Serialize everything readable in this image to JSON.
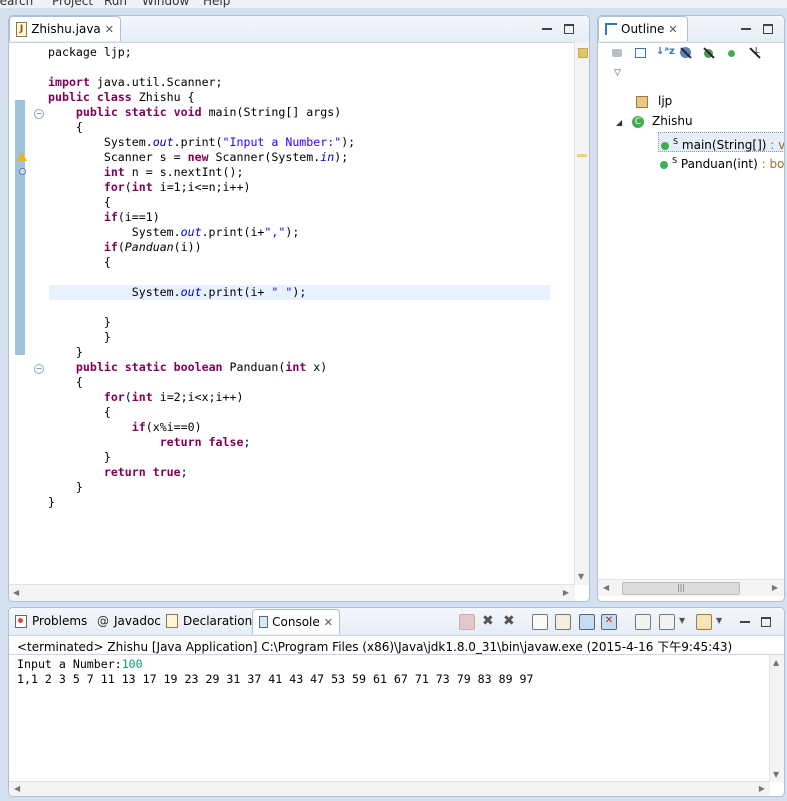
{
  "menubar": {
    "items": [
      "Search",
      "Project",
      "Run",
      "Window",
      "Help"
    ]
  },
  "editor": {
    "tab_label": "Zhishu.java",
    "lines": [
      [
        [
          "t",
          "package ljp;"
        ]
      ],
      [],
      [
        [
          "k",
          "import"
        ],
        [
          "t",
          " java.util.Scanner;"
        ]
      ],
      [
        [
          "k",
          "public"
        ],
        [
          "t",
          " "
        ],
        [
          "k",
          "class"
        ],
        [
          "t",
          " Zhishu {"
        ]
      ],
      [
        [
          "t",
          "    "
        ],
        [
          "k",
          "public"
        ],
        [
          "t",
          " "
        ],
        [
          "k",
          "static"
        ],
        [
          "t",
          " "
        ],
        [
          "k",
          "void"
        ],
        [
          "t",
          " main(String[] args)"
        ]
      ],
      [
        [
          "t",
          "    {"
        ]
      ],
      [
        [
          "t",
          "        System."
        ],
        [
          "f",
          "out"
        ],
        [
          "t",
          ".print("
        ],
        [
          "s",
          "\"Input a Number:\""
        ],
        [
          "t",
          ");"
        ]
      ],
      [
        [
          "t",
          "        Scanner s = "
        ],
        [
          "k",
          "new"
        ],
        [
          "t",
          " Scanner(System."
        ],
        [
          "f",
          "in"
        ],
        [
          "t",
          ");"
        ]
      ],
      [
        [
          "t",
          "        "
        ],
        [
          "k",
          "int"
        ],
        [
          "t",
          " n = s.nextInt();"
        ]
      ],
      [
        [
          "t",
          "        "
        ],
        [
          "k",
          "for"
        ],
        [
          "t",
          "("
        ],
        [
          "k",
          "int"
        ],
        [
          "t",
          " i=1;i<=n;i++)"
        ]
      ],
      [
        [
          "t",
          "        {"
        ]
      ],
      [
        [
          "t",
          "        "
        ],
        [
          "k",
          "if"
        ],
        [
          "t",
          "(i==1)"
        ]
      ],
      [
        [
          "t",
          "            System."
        ],
        [
          "f",
          "out"
        ],
        [
          "t",
          ".print(i+"
        ],
        [
          "s",
          "\",\""
        ],
        [
          "t",
          ");"
        ]
      ],
      [
        [
          "t",
          "        "
        ],
        [
          "k",
          "if"
        ],
        [
          "t",
          "("
        ],
        [
          "i",
          "Panduan"
        ],
        [
          "t",
          "(i))"
        ]
      ],
      [
        [
          "t",
          "        {"
        ]
      ],
      [],
      [
        [
          "t",
          "            System."
        ],
        [
          "f",
          "out"
        ],
        [
          "t",
          ".print(i+ "
        ],
        [
          "s",
          "\" \""
        ],
        [
          "t",
          ");"
        ]
      ],
      [],
      [
        [
          "t",
          "        }"
        ]
      ],
      [
        [
          "t",
          "        }"
        ]
      ],
      [
        [
          "t",
          "    }"
        ]
      ],
      [
        [
          "t",
          "    "
        ],
        [
          "k",
          "public"
        ],
        [
          "t",
          " "
        ],
        [
          "k",
          "static"
        ],
        [
          "t",
          " "
        ],
        [
          "k",
          "boolean"
        ],
        [
          "t",
          " Panduan("
        ],
        [
          "k",
          "int"
        ],
        [
          "t",
          " x)"
        ]
      ],
      [
        [
          "t",
          "    {"
        ]
      ],
      [
        [
          "t",
          "        "
        ],
        [
          "k",
          "for"
        ],
        [
          "t",
          "("
        ],
        [
          "k",
          "int"
        ],
        [
          "t",
          " i=2;i<x;i++)"
        ]
      ],
      [
        [
          "t",
          "        {"
        ]
      ],
      [
        [
          "t",
          "            "
        ],
        [
          "k",
          "if"
        ],
        [
          "t",
          "(x%i==0)"
        ]
      ],
      [
        [
          "t",
          "                "
        ],
        [
          "k",
          "return"
        ],
        [
          "t",
          " "
        ],
        [
          "k",
          "false"
        ],
        [
          "t",
          ";"
        ]
      ],
      [
        [
          "t",
          "        }"
        ]
      ],
      [
        [
          "t",
          "        "
        ],
        [
          "k",
          "return"
        ],
        [
          "t",
          " "
        ],
        [
          "k",
          "true"
        ],
        [
          "t",
          ";"
        ]
      ],
      [
        [
          "t",
          "    }"
        ]
      ],
      [
        [
          "t",
          "}"
        ]
      ]
    ]
  },
  "outline": {
    "tab_label": "Outline",
    "items": [
      {
        "label": "ljp",
        "detail": ""
      },
      {
        "label": "Zhishu",
        "detail": ""
      },
      {
        "label": "main(String[])",
        "detail": " : void"
      },
      {
        "label": "Panduan(int)",
        "detail": " : boolean"
      }
    ]
  },
  "bottom": {
    "tabs": [
      "Problems",
      "Javadoc",
      "Declaration",
      "Console"
    ],
    "tab_glyphs": [
      "@"
    ],
    "status": "<terminated> Zhishu [Java Application] C:\\Program Files (x86)\\Java\\jdk1.8.0_31\\bin\\javaw.exe (2015-4-16 下午9:45:43)",
    "prompt": "Input a Number:",
    "input": "100",
    "output": "1,1 2 3 5 7 11 13 17 19 23 29 31 37 41 43 47 53 59 61 67 71 73 79 83 89 97"
  },
  "colors": {
    "keyword": "#7f0055",
    "string": "#2a00ff",
    "field": "#0000c0",
    "console_input": "#00a868",
    "current_line": "#e8f2fe"
  }
}
